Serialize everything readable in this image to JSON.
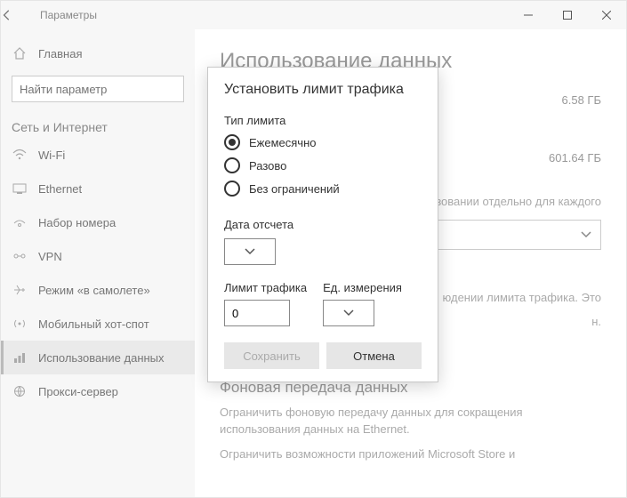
{
  "titlebar": {
    "title": "Параметры"
  },
  "sidebar": {
    "home": "Главная",
    "search_placeholder": "Найти параметр",
    "section": "Сеть и Интернет",
    "items": [
      {
        "label": "Wi-Fi"
      },
      {
        "label": "Ethernet"
      },
      {
        "label": "Набор номера"
      },
      {
        "label": "VPN"
      },
      {
        "label": "Режим «в самолете»"
      },
      {
        "label": "Мобильный хот-спот"
      },
      {
        "label": "Использование данных"
      },
      {
        "label": "Прокси-сервер"
      }
    ]
  },
  "main": {
    "heading": "Использование данных",
    "usage1_value": "6.58 ГБ",
    "usage2_value": "601.64 ГБ",
    "partial1": "зовании отдельно для каждого",
    "partial2": "юдении лимита трафика. Это",
    "bg_head": "Фоновая передача данных",
    "bg_text1": "Ограничить фоновую передачу данных для сокращения использования данных на Ethernet.",
    "bg_text2": "Ограничить возможности приложений Microsoft Store и"
  },
  "modal": {
    "title": "Установить лимит трафика",
    "limit_type_label": "Тип лимита",
    "opt_monthly": "Ежемесячно",
    "opt_once": "Разово",
    "opt_unlimited": "Без ограничений",
    "date_label": "Дата отсчета",
    "limit_label": "Лимит трафика",
    "unit_label": "Ед. измерения",
    "limit_value": "0",
    "save": "Сохранить",
    "cancel": "Отмена"
  }
}
